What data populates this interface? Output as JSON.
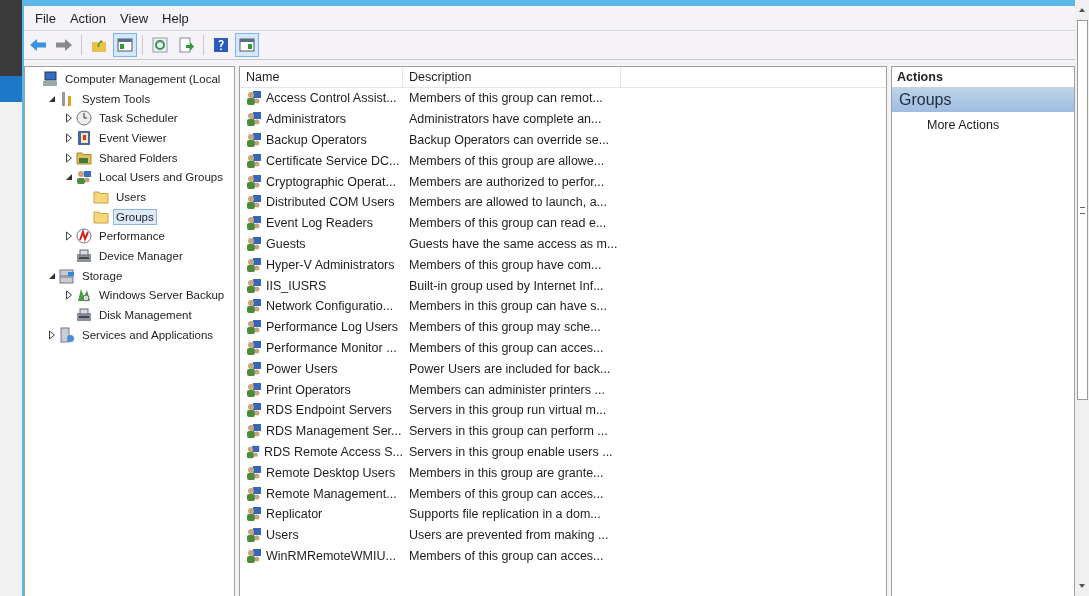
{
  "menu": [
    "File",
    "Action",
    "View",
    "Help"
  ],
  "toolbar": [
    {
      "kind": "back",
      "pressed": false
    },
    {
      "kind": "forward",
      "pressed": false
    },
    {
      "kind": "sep"
    },
    {
      "kind": "up",
      "pressed": false
    },
    {
      "kind": "tree-pane",
      "pressed": true
    },
    {
      "kind": "sep"
    },
    {
      "kind": "refresh",
      "pressed": false
    },
    {
      "kind": "export",
      "pressed": false
    },
    {
      "kind": "sep"
    },
    {
      "kind": "help",
      "pressed": false
    },
    {
      "kind": "action-pane",
      "pressed": true
    }
  ],
  "tree": [
    {
      "label": "Computer Management (Local",
      "kind": "computer",
      "selected": false,
      "children": [
        {
          "label": "System Tools",
          "kind": "tools",
          "expanded": true,
          "selected": false,
          "children": [
            {
              "label": "Task Scheduler",
              "kind": "clock",
              "expanded": false,
              "selected": false
            },
            {
              "label": "Event Viewer",
              "kind": "log",
              "expanded": false,
              "selected": false
            },
            {
              "label": "Shared Folders",
              "kind": "share",
              "expanded": false,
              "selected": false
            },
            {
              "label": "Local Users and Groups",
              "kind": "users",
              "expanded": true,
              "selected": false,
              "children": [
                {
                  "label": "Users",
                  "kind": "folder",
                  "selected": false
                },
                {
                  "label": "Groups",
                  "kind": "folder",
                  "selected": true
                }
              ]
            },
            {
              "label": "Performance",
              "kind": "perf",
              "expanded": false,
              "selected": false
            },
            {
              "label": "Device Manager",
              "kind": "device",
              "selected": false
            }
          ]
        },
        {
          "label": "Storage",
          "kind": "storage",
          "expanded": true,
          "selected": false,
          "children": [
            {
              "label": "Windows Server Backup",
              "kind": "backup",
              "expanded": false,
              "selected": false
            },
            {
              "label": "Disk Management",
              "kind": "device",
              "selected": false
            }
          ]
        },
        {
          "label": "Services and Applications",
          "kind": "services",
          "expanded": false,
          "selected": false
        }
      ]
    }
  ],
  "table": {
    "columns": [
      "Name",
      "Description"
    ],
    "rows": [
      {
        "name": "Access Control Assist...",
        "description": "Members of this group can remot..."
      },
      {
        "name": "Administrators",
        "description": "Administrators have complete an..."
      },
      {
        "name": "Backup Operators",
        "description": "Backup Operators can override se..."
      },
      {
        "name": "Certificate Service DC...",
        "description": "Members of this group are allowe..."
      },
      {
        "name": "Cryptographic Operat...",
        "description": "Members are authorized to perfor..."
      },
      {
        "name": "Distributed COM Users",
        "description": "Members are allowed to launch, a..."
      },
      {
        "name": "Event Log Readers",
        "description": "Members of this group can read e..."
      },
      {
        "name": "Guests",
        "description": "Guests have the same access as m..."
      },
      {
        "name": "Hyper-V Administrators",
        "description": "Members of this group have com..."
      },
      {
        "name": "IIS_IUSRS",
        "description": "Built-in group used by Internet Inf..."
      },
      {
        "name": "Network Configuratio...",
        "description": "Members in this group can have s..."
      },
      {
        "name": "Performance Log Users",
        "description": "Members of this group may sche..."
      },
      {
        "name": "Performance Monitor ...",
        "description": "Members of this group can acces..."
      },
      {
        "name": "Power Users",
        "description": "Power Users are included for back..."
      },
      {
        "name": "Print Operators",
        "description": "Members can administer printers ..."
      },
      {
        "name": "RDS Endpoint Servers",
        "description": "Servers in this group run virtual m..."
      },
      {
        "name": "RDS Management Ser...",
        "description": "Servers in this group can perform ..."
      },
      {
        "name": "RDS Remote Access S...",
        "description": "Servers in this group enable users ..."
      },
      {
        "name": "Remote Desktop Users",
        "description": "Members in this group are grante..."
      },
      {
        "name": "Remote Management...",
        "description": "Members of this group can acces..."
      },
      {
        "name": "Replicator",
        "description": "Supports file replication in a dom..."
      },
      {
        "name": "Users",
        "description": "Users are prevented from making ..."
      },
      {
        "name": "WinRMRemoteWMIU...",
        "description": "Members of this group can acces..."
      }
    ]
  },
  "actions": {
    "title": "Actions",
    "section": "Groups",
    "items": [
      "More Actions"
    ]
  }
}
